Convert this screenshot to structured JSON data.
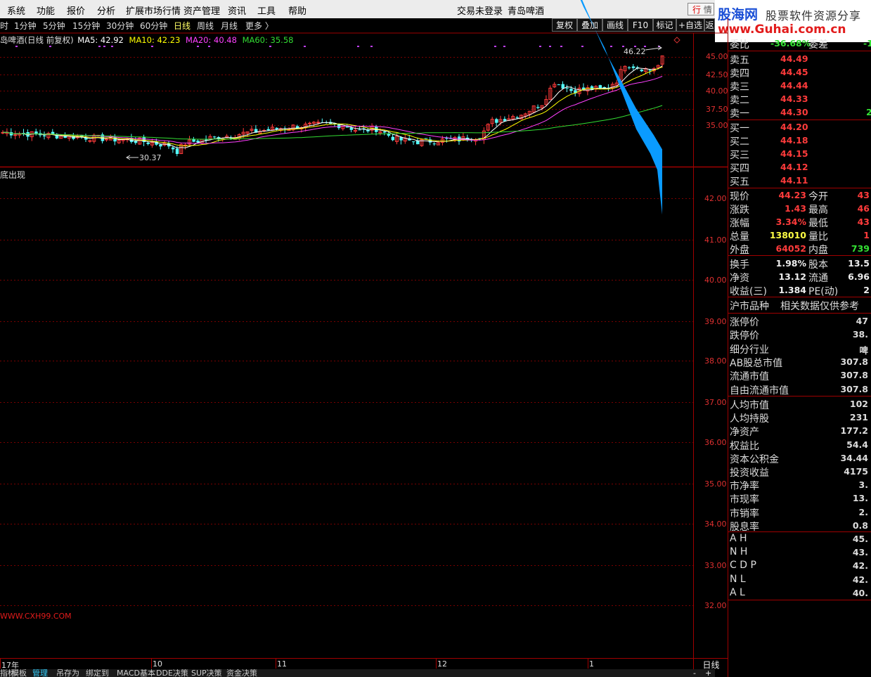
{
  "menu": [
    "系统",
    "功能",
    "报价",
    "分析",
    "扩展市场行情",
    "资产管理",
    "资讯",
    "工具",
    "帮助"
  ],
  "login_status": "交易未登录",
  "stock_title": "青岛啤酒",
  "hq_tab": {
    "a": "行",
    "b": "情"
  },
  "logo": {
    "name": "股海网",
    "tagline": "股票软件资源分享",
    "url": "www.Guhai.com.cn"
  },
  "periods": [
    "时",
    "1分钟",
    "5分钟",
    "15分钟",
    "30分钟",
    "60分钟",
    "日线",
    "周线",
    "月线",
    "更多 〉"
  ],
  "active_period": "日线",
  "toolbar": [
    "复权",
    "叠加",
    "画线",
    "F10",
    "标记",
    "+自选",
    "返"
  ],
  "ma": {
    "title": "岛啤酒(日线 前复权)",
    "ma5": "MA5: 42.92",
    "ma10": "MA10: 42.23",
    "ma20": "MA20: 40.48",
    "ma60": "MA60: 35.58",
    "colors": {
      "ma5": "#ffffff",
      "ma10": "#ffff00",
      "ma20": "#ff40ff",
      "ma60": "#33dd33"
    }
  },
  "price_axis": [
    "45.00",
    "42.50",
    "40.00",
    "37.50",
    "35.00"
  ],
  "annotations": {
    "high": "46.22",
    "low": "30.37"
  },
  "indicator_label": "底出现",
  "indicator_axis": [
    "42.00",
    "41.00",
    "40.00",
    "39.00",
    "38.00",
    "37.00",
    "36.00",
    "35.00",
    "34.00",
    "33.00",
    "32.00"
  ],
  "watermark": "WWW.CXH99.COM",
  "time_axis": [
    "17年",
    "10",
    "11",
    "12",
    "1"
  ],
  "day_label": "日线",
  "bottom_tabs": [
    "指标",
    "模板",
    "管理",
    "吊存为",
    "绑定到",
    "MACD基本",
    "DDE决策",
    "SUP决策",
    "资金决策"
  ],
  "bottom_tab_active": "管理",
  "panel": {
    "weibi": {
      "label": "委比",
      "value": "-36.68%",
      "label2": "委差",
      "value2": "-1"
    },
    "sell": [
      {
        "label": "卖五",
        "price": "44.49",
        "vol": ""
      },
      {
        "label": "卖四",
        "price": "44.45",
        "vol": ""
      },
      {
        "label": "卖三",
        "price": "44.44",
        "vol": ""
      },
      {
        "label": "卖二",
        "price": "44.33",
        "vol": ""
      },
      {
        "label": "卖一",
        "price": "44.30",
        "vol": "2"
      }
    ],
    "buy": [
      {
        "label": "买一",
        "price": "44.20"
      },
      {
        "label": "买二",
        "price": "44.18"
      },
      {
        "label": "买三",
        "price": "44.15"
      },
      {
        "label": "买四",
        "price": "44.12"
      },
      {
        "label": "买五",
        "price": "44.11"
      }
    ],
    "quote": [
      {
        "l1": "现价",
        "v1": "44.23",
        "c1": "red",
        "l2": "今开",
        "v2": "43",
        "c2": "red"
      },
      {
        "l1": "涨跌",
        "v1": "1.43",
        "c1": "red",
        "l2": "最高",
        "v2": "46",
        "c2": "red"
      },
      {
        "l1": "涨幅",
        "v1": "3.34%",
        "c1": "red",
        "l2": "最低",
        "v2": "43",
        "c2": "red"
      },
      {
        "l1": "总量",
        "v1": "138010",
        "c1": "yellow",
        "l2": "量比",
        "v2": "1",
        "c2": "red"
      },
      {
        "l1": "外盘",
        "v1": "64052",
        "c1": "red",
        "l2": "内盘",
        "v2": "739",
        "c2": "green"
      }
    ],
    "fin": [
      {
        "l1": "换手",
        "v1": "1.98%",
        "l2": "股本",
        "v2": "13.5"
      },
      {
        "l1": "净资",
        "v1": "13.12",
        "l2": "流通",
        "v2": "6.96"
      },
      {
        "l1": "收益(三)",
        "v1": "1.384",
        "l2": "PE(动)",
        "v2": "2"
      }
    ],
    "market_header": {
      "a": "沪市品种",
      "b": "相关数据仅供参考"
    },
    "limits": [
      {
        "label": "涨停价",
        "value": "47",
        "color": "red"
      },
      {
        "label": "跌停价",
        "value": "38.",
        "color": "green"
      },
      {
        "label": "细分行业",
        "value": "啤",
        "color": "yellow"
      },
      {
        "label": "AB股总市值",
        "value": "307.8",
        "color": "white"
      },
      {
        "label": "流通市值",
        "value": "307.8",
        "color": "white"
      },
      {
        "label": "自由流通市值",
        "value": "307.8",
        "color": "white"
      }
    ],
    "stats": [
      {
        "label": "人均市值",
        "value": "102"
      },
      {
        "label": "人均持股",
        "value": "231"
      },
      {
        "label": "净资产",
        "value": "177.2"
      },
      {
        "label": "权益比",
        "value": "54.4"
      },
      {
        "label": "资本公积金",
        "value": "34.44"
      },
      {
        "label": "投资收益",
        "value": "4175"
      },
      {
        "label": "市净率",
        "value": "3."
      },
      {
        "label": "市现率",
        "value": "13."
      },
      {
        "label": "市销率",
        "value": "2."
      },
      {
        "label": "股息率",
        "value": "0.8"
      }
    ],
    "indices": [
      {
        "label": "A H",
        "value": "45.",
        "color": "red"
      },
      {
        "label": "N H",
        "value": "43.",
        "color": "red"
      },
      {
        "label": "C D P",
        "value": "42.",
        "color": "red"
      },
      {
        "label": "N L",
        "value": "42.",
        "color": "green"
      },
      {
        "label": "A L",
        "value": "40.",
        "color": "green"
      }
    ]
  }
}
